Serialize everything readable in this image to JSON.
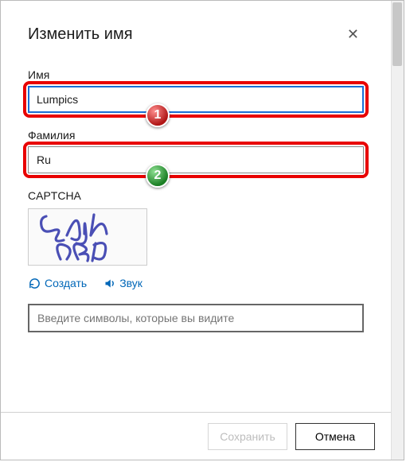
{
  "dialog": {
    "title": "Изменить имя",
    "close_glyph": "✕"
  },
  "fields": {
    "first_name": {
      "label": "Имя",
      "value": "Lumpics"
    },
    "last_name": {
      "label": "Фамилия",
      "value": "Ru"
    }
  },
  "badges": {
    "one": "1",
    "two": "2"
  },
  "captcha": {
    "label": "CAPTCHA",
    "image_text": "GdyN JSM",
    "new_label": "Создать",
    "audio_label": "Звук",
    "input_placeholder": "Введите символы, которые вы видите"
  },
  "footer": {
    "save_label": "Сохранить",
    "cancel_label": "Отмена"
  }
}
